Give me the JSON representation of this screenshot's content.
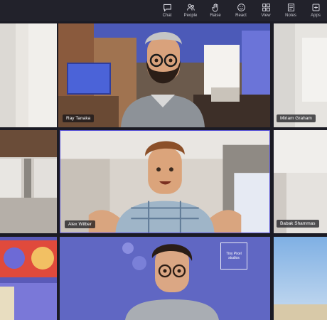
{
  "toolbar": {
    "items": [
      {
        "label": "Chat",
        "icon": "chat-icon"
      },
      {
        "label": "People",
        "icon": "people-icon"
      },
      {
        "label": "Raise",
        "icon": "raise-hand-icon"
      },
      {
        "label": "React",
        "icon": "react-icon"
      },
      {
        "label": "View",
        "icon": "view-icon"
      },
      {
        "label": "Notes",
        "icon": "notes-icon"
      },
      {
        "label": "Apps",
        "icon": "apps-icon"
      }
    ]
  },
  "participants": {
    "ray": {
      "name": "Ray Tanaka"
    },
    "miriam": {
      "name": "Miriam Graham"
    },
    "alex": {
      "name": "Alex Wilber"
    },
    "babak": {
      "name": "Babak Shammas"
    }
  },
  "wall_logo": {
    "line1": "Tiny Pixel",
    "line2": "studios"
  },
  "colors": {
    "accent": "#6e63ff",
    "tile_border": "#5b55d6"
  }
}
